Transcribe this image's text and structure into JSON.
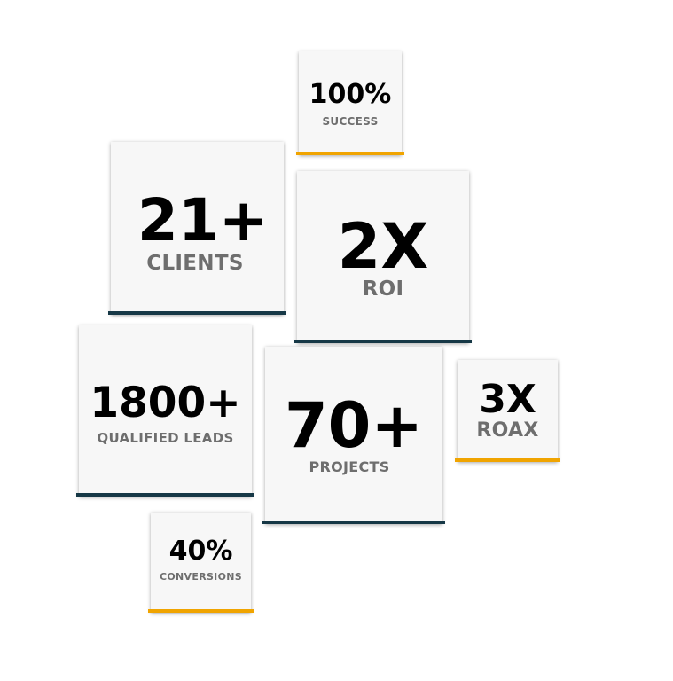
{
  "stats": [
    {
      "id": "success",
      "value": "100%",
      "label": "SUCCESS"
    },
    {
      "id": "clients",
      "value": "21+",
      "label": "CLIENTS"
    },
    {
      "id": "roi",
      "value": "2X",
      "label": "ROI"
    },
    {
      "id": "leads",
      "value": "1800+",
      "label": "QUALIFIED LEADS"
    },
    {
      "id": "projects",
      "value": "70+",
      "label": "PROJECTS"
    },
    {
      "id": "roax",
      "value": "3X",
      "label": "ROAX"
    },
    {
      "id": "conversions",
      "value": "40%",
      "label": "CONVERSIONS"
    }
  ],
  "colors": {
    "navy_accent": "#163846",
    "gold_accent": "#f0a400",
    "card_bg": "#f7f7f7",
    "label_gray": "#6e6e6e"
  }
}
